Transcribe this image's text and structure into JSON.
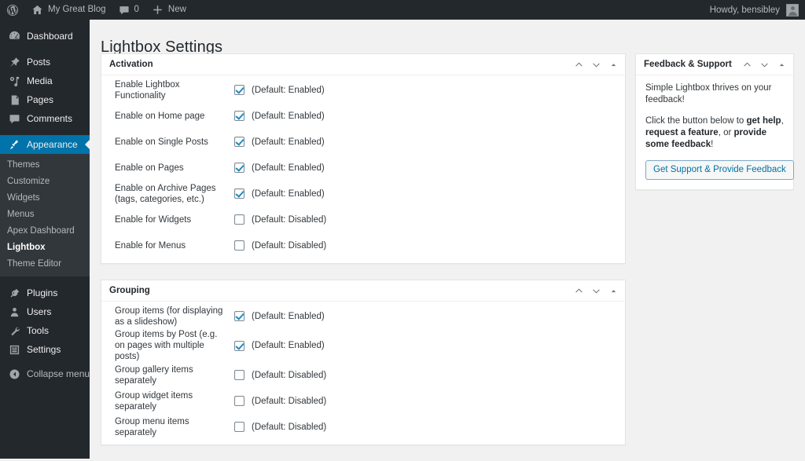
{
  "adminbar": {
    "wp_logo_icon": "wordpress-logo-icon",
    "site_icon": "home-icon",
    "site_name": "My Great Blog",
    "comments_icon": "comment-bubble-icon",
    "comments_count": "0",
    "new_icon": "plus-icon",
    "new_label": "New",
    "howdy": "Howdy, bensibley",
    "avatar": "user-avatar"
  },
  "sidebar": {
    "top_items": [
      {
        "label": "Dashboard",
        "icon": "dashboard-icon",
        "current": false
      },
      {
        "label": "Posts",
        "icon": "pin-icon",
        "current": false
      },
      {
        "label": "Media",
        "icon": "media-icon",
        "current": false
      },
      {
        "label": "Pages",
        "icon": "pages-icon",
        "current": false
      },
      {
        "label": "Comments",
        "icon": "comment-bubble-icon",
        "current": false
      },
      {
        "label": "Appearance",
        "icon": "paintbrush-icon",
        "current": true
      }
    ],
    "submenu": [
      {
        "label": "Themes",
        "current": false
      },
      {
        "label": "Customize",
        "current": false
      },
      {
        "label": "Widgets",
        "current": false
      },
      {
        "label": "Menus",
        "current": false
      },
      {
        "label": "Apex Dashboard",
        "current": false
      },
      {
        "label": "Lightbox",
        "current": true
      },
      {
        "label": "Theme Editor",
        "current": false
      }
    ],
    "bottom_items": [
      {
        "label": "Plugins",
        "icon": "plug-icon"
      },
      {
        "label": "Users",
        "icon": "users-icon"
      },
      {
        "label": "Tools",
        "icon": "wrench-icon"
      },
      {
        "label": "Settings",
        "icon": "settings-sliders-icon"
      }
    ],
    "collapse": {
      "label": "Collapse menu",
      "icon": "collapse-arrow-icon"
    }
  },
  "page": {
    "title": "Lightbox Settings"
  },
  "handle_actions": {
    "order_higher_icon": "chevron-up-icon",
    "order_lower_icon": "chevron-down-icon",
    "toggle_icon": "caret-up-icon"
  },
  "panels": [
    {
      "id": "activation",
      "title": "Activation",
      "rows": [
        {
          "label": "Enable Lightbox Functionality",
          "checked": true,
          "default_text": "(Default: Enabled)"
        },
        {
          "label": "Enable on Home page",
          "checked": true,
          "default_text": "(Default: Enabled)"
        },
        {
          "label": "Enable on Single Posts",
          "checked": true,
          "default_text": "(Default: Enabled)"
        },
        {
          "label": "Enable on Pages",
          "checked": true,
          "default_text": "(Default: Enabled)"
        },
        {
          "label": "Enable on Archive Pages (tags, categories, etc.)",
          "checked": true,
          "default_text": "(Default: Enabled)"
        },
        {
          "label": "Enable for Widgets",
          "checked": false,
          "default_text": "(Default: Disabled)"
        },
        {
          "label": "Enable for Menus",
          "checked": false,
          "default_text": "(Default: Disabled)"
        }
      ]
    },
    {
      "id": "grouping",
      "title": "Grouping",
      "rows": [
        {
          "label": "Group items (for displaying as a slideshow)",
          "checked": true,
          "default_text": "(Default: Enabled)"
        },
        {
          "label": "Group items by Post (e.g. on pages with multiple posts)",
          "checked": true,
          "default_text": "(Default: Enabled)"
        },
        {
          "label": "Group gallery items separately",
          "checked": false,
          "default_text": "(Default: Disabled)"
        },
        {
          "label": "Group widget items separately",
          "checked": false,
          "default_text": "(Default: Disabled)"
        },
        {
          "label": "Group menu items separately",
          "checked": false,
          "default_text": "(Default: Disabled)"
        }
      ]
    }
  ],
  "feedback": {
    "title": "Feedback & Support",
    "line1": "Simple Lightbox thrives on your feedback!",
    "line2_parts": [
      {
        "text": "Click the button below to ",
        "bold": false
      },
      {
        "text": "get help",
        "bold": true
      },
      {
        "text": ", ",
        "bold": false
      },
      {
        "text": "request a feature",
        "bold": true
      },
      {
        "text": ", or ",
        "bold": false
      },
      {
        "text": "provide some feedback",
        "bold": true
      },
      {
        "text": "!",
        "bold": false
      }
    ],
    "button_label": "Get Support & Provide Feedback"
  },
  "colors": {
    "adminbar_bg": "#23282d",
    "menu_bg": "#23282d",
    "submenu_bg": "#32373c",
    "current_menu_bg": "#0073aa",
    "content_bg": "#f1f1f1",
    "panel_bg": "#ffffff",
    "panel_border": "#e2e4e7",
    "checkbox_check": "#1e8cbe",
    "link_blue": "#0071a1"
  }
}
